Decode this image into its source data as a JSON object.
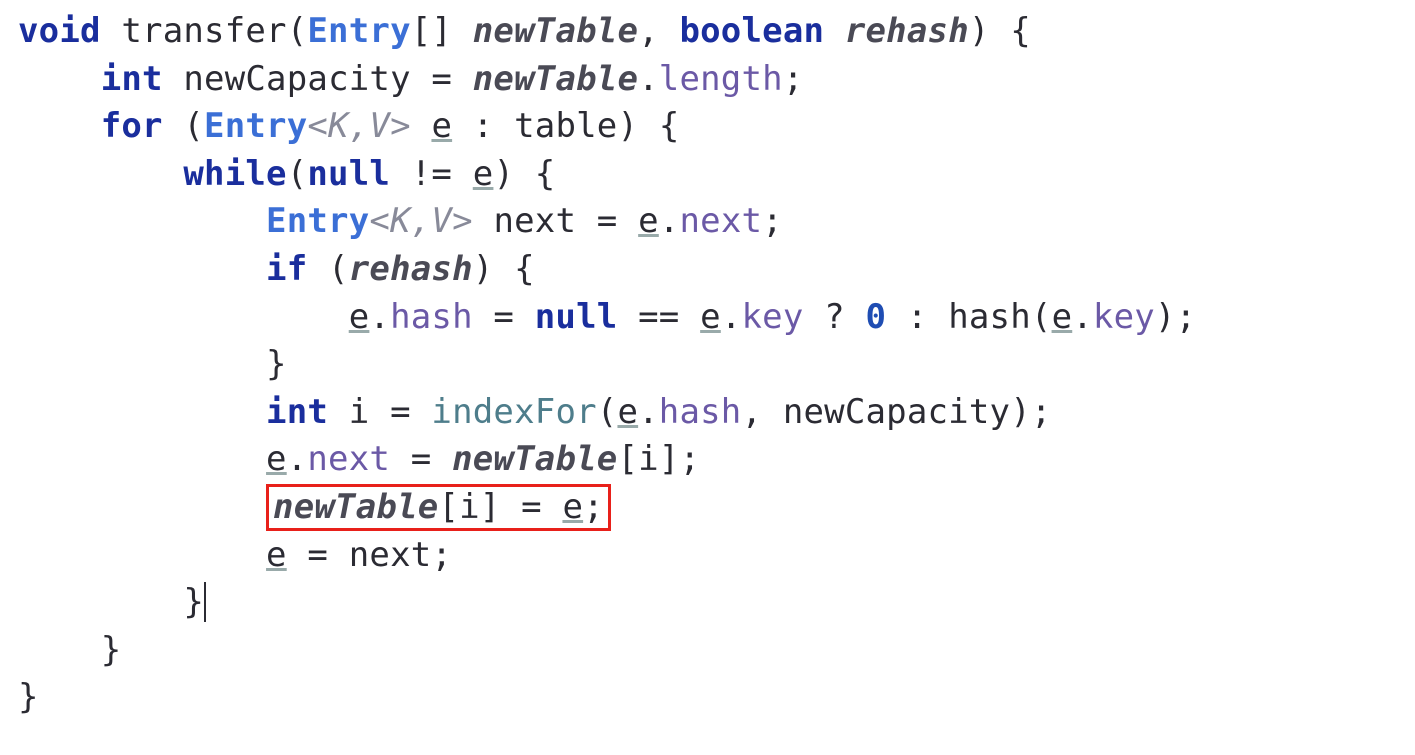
{
  "code": {
    "l1": {
      "kw_void": "void",
      "sp": " ",
      "fn": "transfer",
      "open": "(",
      "type": "Entry",
      "arr": "[]",
      "sp2": " ",
      "p1": "newTable",
      "comma": ", ",
      "kw_bool": "boolean",
      "sp3": " ",
      "p2": "rehash",
      "close": ") {"
    },
    "l2": {
      "indent": "    ",
      "kw_int": "int",
      "sp": " ",
      "id": "newCapacity",
      "eq": " = ",
      "p": "newTable",
      "dot": ".",
      "m": "length",
      "semi": ";"
    },
    "l3": {
      "indent": "    ",
      "kw_for": "for",
      "sp": " (",
      "type": "Entry",
      "gen": "<K,V>",
      "sp2": " ",
      "e": "e",
      "sp3": " : ",
      "t": "table",
      "close": ") {"
    },
    "l4": {
      "indent": "        ",
      "kw_while": "while",
      "open": "(",
      "kw_null": "null",
      "neq": " != ",
      "e": "e",
      "close": ") {"
    },
    "l5": {
      "indent": "            ",
      "type": "Entry",
      "gen": "<K,V>",
      "sp": " ",
      "next": "next",
      "eq": " = ",
      "e": "e",
      "dot": ".",
      "m": "next",
      "semi": ";"
    },
    "l6": {
      "indent": "            ",
      "kw_if": "if",
      "sp": " (",
      "p": "rehash",
      "close": ") {"
    },
    "l7": {
      "indent": "                ",
      "e": "e",
      "dot": ".",
      "m": "hash",
      "eq": " = ",
      "kw_null": "null",
      "eqq": " == ",
      "e2": "e",
      "dot2": ".",
      "m2": "key",
      "q": " ? ",
      "zero": "0",
      "colon": " : ",
      "call": "hash",
      "open": "(",
      "e3": "e",
      "dot3": ".",
      "m3": "key",
      "close": ");"
    },
    "l8": {
      "indent": "            ",
      "brace": "}"
    },
    "l9": {
      "indent": "            ",
      "kw_int": "int",
      "sp": " ",
      "i": "i",
      "eq": " = ",
      "call": "indexFor",
      "open": "(",
      "e": "e",
      "dot": ".",
      "m": "hash",
      "comma": ", ",
      "nc": "newCapacity",
      "close": ");"
    },
    "l10": {
      "indent": "            ",
      "e": "e",
      "dot": ".",
      "m": "next",
      "eq": " = ",
      "p": "newTable",
      "open": "[",
      "i": "i",
      "close": "];"
    },
    "l11": {
      "indent": "            ",
      "p": "newTable",
      "open": "[",
      "i": "i",
      "close": "]",
      "eq": " = ",
      "e": "e",
      "semi": ";"
    },
    "l12": {
      "indent": "            ",
      "e": "e",
      "eq": " = ",
      "next": "next",
      "semi": ";"
    },
    "l13": {
      "indent": "        ",
      "brace": "}"
    },
    "l14": {
      "indent": "    ",
      "brace": "}"
    },
    "l15": {
      "brace": "}"
    }
  }
}
